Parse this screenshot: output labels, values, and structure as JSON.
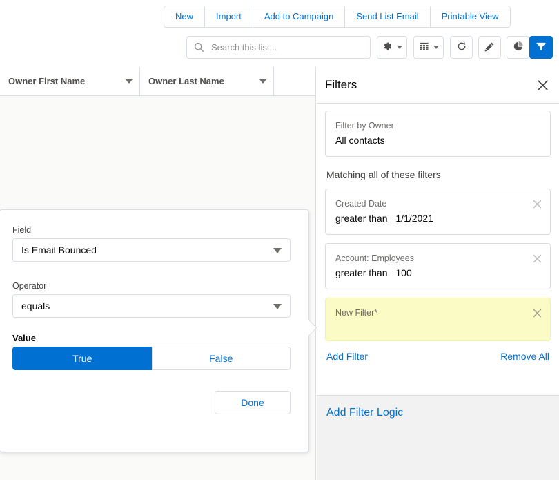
{
  "action_bar": {
    "buttons": [
      {
        "label": "New"
      },
      {
        "label": "Import"
      },
      {
        "label": "Add to Campaign"
      },
      {
        "label": "Send List Email"
      },
      {
        "label": "Printable View"
      }
    ]
  },
  "toolbar": {
    "search": {
      "placeholder": "Search this list...",
      "value": "",
      "icon": "search-icon"
    },
    "icons": [
      {
        "name": "list-settings-gear-icon",
        "has_caret": true,
        "active": false
      },
      {
        "name": "display-as-table-icon",
        "has_caret": true,
        "active": false
      },
      {
        "name": "refresh-icon",
        "has_caret": false,
        "active": false
      },
      {
        "name": "edit-pencil-icon",
        "has_caret": false,
        "active": false
      },
      {
        "name": "chart-pie-icon",
        "has_caret": false,
        "active": false
      },
      {
        "name": "filter-funnel-icon",
        "has_caret": false,
        "active": true
      }
    ]
  },
  "table": {
    "columns": [
      {
        "label": "Owner First Name"
      },
      {
        "label": "Owner Last Name"
      }
    ],
    "rows": []
  },
  "filters_panel": {
    "title": "Filters",
    "close_icon": "close-icon",
    "owner_filter": {
      "label": "Filter by Owner",
      "value": "All contacts"
    },
    "matching_label": "Matching all of these filters",
    "filters": [
      {
        "field": "Created Date",
        "operator": "greater than",
        "value": "1/1/2021",
        "highlighted": false,
        "remove_icon": "remove-filter-icon"
      },
      {
        "field": "Account: Employees",
        "operator": "greater than",
        "value": "100",
        "highlighted": false,
        "remove_icon": "remove-filter-icon"
      },
      {
        "field": "New Filter*",
        "operator": "",
        "value": "",
        "highlighted": true,
        "remove_icon": "remove-filter-icon"
      }
    ],
    "add_filter_label": "Add Filter",
    "remove_all_label": "Remove All",
    "add_filter_logic_label": "Add Filter Logic"
  },
  "filter_editor": {
    "field_label": "Field",
    "field_value": "Is Email Bounced",
    "operator_label": "Operator",
    "operator_value": "equals",
    "value_label": "Value",
    "value_options": [
      {
        "label": "True",
        "selected": true
      },
      {
        "label": "False",
        "selected": false
      }
    ],
    "done_label": "Done"
  },
  "colors": {
    "brand_blue": "#0070D2",
    "link_blue": "#0070D2",
    "highlight_yellow": "#FBFBC6",
    "border_gray": "#D8DDE6",
    "panel_gray": "#F3F2F2",
    "table_bg": "#FAFAF9",
    "text_dark": "#080707",
    "text_muted": "#706E6B"
  }
}
